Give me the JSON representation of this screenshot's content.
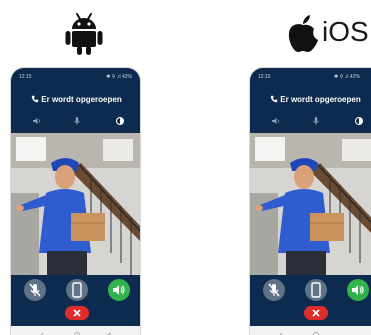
{
  "platforms": {
    "android": {
      "icon": "android-robot-icon"
    },
    "ios": {
      "icon": "apple-icon",
      "label": "iOS"
    }
  },
  "phones": [
    {
      "platform": "android",
      "status_time": "12:15",
      "status_right": "✱ ⚲ .ıl 42%",
      "call_title": "Er wordt opgeroepen",
      "controls": [
        "volume-icon",
        "microphone-icon",
        "brightness-icon"
      ],
      "buttons": [
        "mute-microphone-button",
        "display-button",
        "speaker-button"
      ],
      "end_button": "end-call-button"
    },
    {
      "platform": "ios",
      "status_time": "12:15",
      "status_right": "✱ ⚲ .ıl 42%",
      "call_title": "Er wordt opgeroepen",
      "controls": [
        "volume-icon",
        "microphone-icon",
        "brightness-icon"
      ],
      "buttons": [
        "mute-microphone-button",
        "display-button",
        "speaker-button"
      ],
      "end_button": "end-call-button"
    }
  ],
  "colors": {
    "phone_bg": "#0d2b4f",
    "button_grey": "#5f7288",
    "speaker_green": "#2fb34a",
    "end_red": "#e02c2c"
  }
}
